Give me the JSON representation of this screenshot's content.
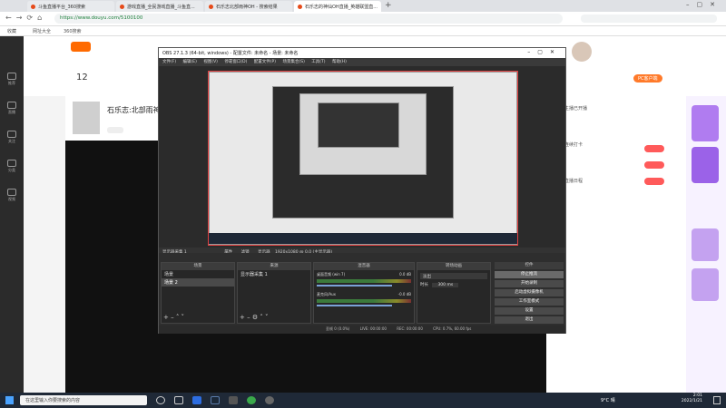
{
  "tabs": [
    {
      "label": "斗鱼直播平台_360搜索",
      "active": false
    },
    {
      "label": "游戏直播_全民游戏直播_斗鱼直...",
      "active": false
    },
    {
      "label": "石乐志北部雨神OH - 搜索结果",
      "active": false
    },
    {
      "label": "石乐志的神仙OH直播_英雄联盟直...",
      "active": true
    }
  ],
  "address": {
    "url": "https://www.douyu.com/5100100"
  },
  "bookmarks": [
    {
      "label": "收藏"
    },
    {
      "label": "网址大全"
    },
    {
      "label": "360搜索"
    }
  ],
  "site": {
    "left_nav": [
      "推荐",
      "直播",
      "关注",
      "分类",
      "视频"
    ],
    "level_number": "12",
    "streamer_name": "石乐志:北部雨神3",
    "right_panel_hint": "PC客户端",
    "side_texts": [
      "主播已开播",
      "连续打卡",
      "直播日程"
    ]
  },
  "obs": {
    "title": "OBS 27.1.3 (64-bit, windows) - 配置文件: 未命名 - 场景: 未命名",
    "menu": [
      "文件(F)",
      "编辑(E)",
      "视图(V)",
      "停靠窗口(D)",
      "配置文件(P)",
      "场景集合(S)",
      "工具(T)",
      "帮助(H)"
    ],
    "source_toolbar": [
      "显示器采集 1",
      "属性",
      "滤镜",
      "显示器",
      "1920x1080 @ 0,0 (主显示器)"
    ],
    "docks": {
      "scenes": {
        "title": "场景",
        "items": [
          "场景",
          "场景 2"
        ]
      },
      "sources": {
        "title": "来源",
        "items": [
          "显示器采集 1"
        ]
      },
      "mixer": {
        "title": "混音器",
        "channels": [
          {
            "name": "桌面音频 (win 7)",
            "db": "0.0 dB"
          },
          {
            "name": "麦克风/Aux",
            "db": "-0.0 dB"
          }
        ]
      },
      "transitions": {
        "title": "转场动画",
        "type": "淡出",
        "duration_label": "时长",
        "duration": "300 ms"
      },
      "controls": {
        "title": "控件",
        "buttons": [
          "停止推流",
          "开始录制",
          "启动虚拟摄像机",
          "工作室模式",
          "设置",
          "退出"
        ]
      }
    },
    "status": {
      "dropped": "丢帧 0 (0.0%)",
      "live": "LIVE: 00:00:00",
      "rec": "REC: 00:00:00",
      "cpu": "CPU: 0.7%, 60.00 fps"
    }
  },
  "taskbar": {
    "search_placeholder": "在这里输入你要搜索的内容",
    "weather": "9°C 晴",
    "time": "2:01",
    "date": "2022/1/21"
  }
}
